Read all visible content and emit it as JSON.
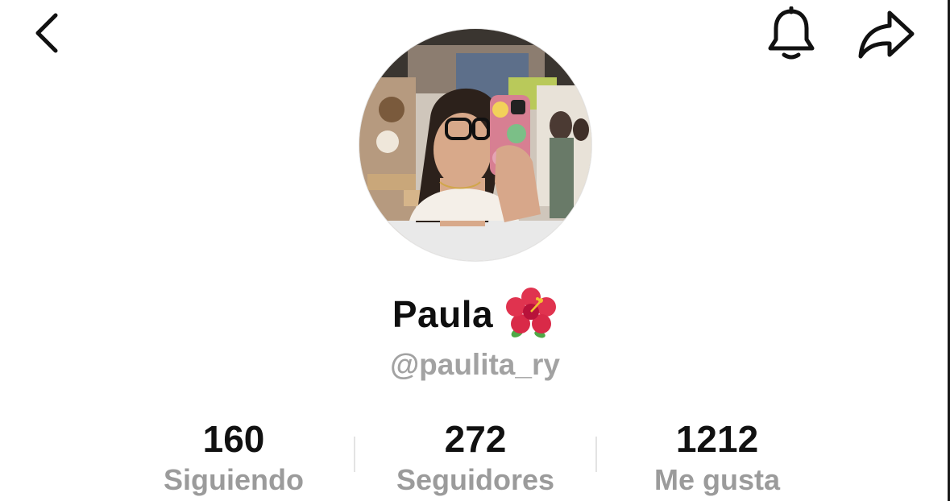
{
  "header": {
    "back_icon": "chevron-left-icon",
    "notification_icon": "bell-icon",
    "share_icon": "share-arrow-icon"
  },
  "profile": {
    "display_name": "Paula",
    "name_emoji": "hibiscus-icon",
    "username": "@paulita_ry",
    "avatar": "profile-photo"
  },
  "stats": [
    {
      "value": "160",
      "label": "Siguiendo"
    },
    {
      "value": "272",
      "label": "Seguidores"
    },
    {
      "value": "1212",
      "label": "Me gusta"
    }
  ],
  "colors": {
    "primary_text": "#111111",
    "secondary_text": "#a2a2a2",
    "divider": "#e3e3e3",
    "background": "#ffffff",
    "hibiscus": "#e0334f"
  }
}
